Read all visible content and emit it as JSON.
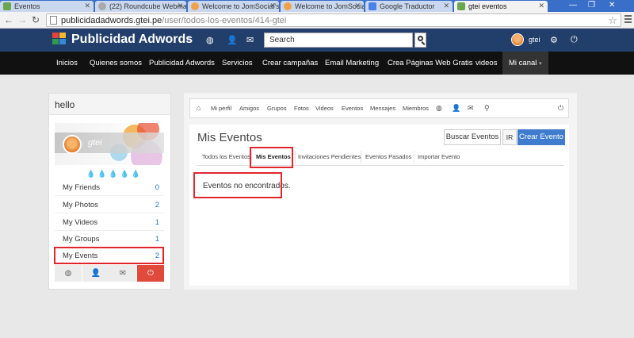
{
  "browser": {
    "tabs": [
      {
        "label": "Eventos",
        "active": false
      },
      {
        "label": "(22) Roundcube Webmail",
        "active": false
      },
      {
        "label": "Welcome to JomSocial's C",
        "active": false
      },
      {
        "label": "Welcome to JomSocial's C",
        "active": false
      },
      {
        "label": "Google Traductor",
        "active": false
      },
      {
        "label": "gtei eventos",
        "active": true
      }
    ],
    "url_host": "publicidadadwords.gtei.pe",
    "url_path": "/user/todos-los-eventos/414-gtei"
  },
  "header": {
    "site_title": "Publicidad Adwords",
    "search_placeholder": "Search",
    "username": "gtei"
  },
  "mainnav": {
    "items": [
      "Inicios",
      "Quienes somos",
      "Publicidad Adwords",
      "Servicios",
      "Crear campañas",
      "Email Marketing",
      "Crea Páginas Web Gratis",
      "videos"
    ],
    "active_item": "Mi canal"
  },
  "sidebar": {
    "title": "hello",
    "cover_name": "gtei",
    "rows": [
      {
        "label": "My Friends",
        "count": "0"
      },
      {
        "label": "My Photos",
        "count": "2"
      },
      {
        "label": "My Videos",
        "count": "1"
      },
      {
        "label": "My Groups",
        "count": "1"
      },
      {
        "label": "My Events",
        "count": "2"
      }
    ]
  },
  "profile_toolbar": {
    "items": [
      "Mi perfil",
      "Amigos",
      "Grupos",
      "Fotos",
      "Videos",
      "Eventos",
      "Mensajes",
      "Miembros"
    ]
  },
  "events": {
    "title": "Mis Eventos",
    "search_button": "Buscar Eventos",
    "ir_button": "IR",
    "create_button": "Crear Evento",
    "subtabs": [
      "Todos los Eventos",
      "Mis Eventos",
      "Invitaciones Pendientes",
      "Eventos Pasados",
      "Importar Evento"
    ],
    "empty_message": "Eventos no encontrados."
  },
  "colors": {
    "header_bg": "#223e6b",
    "nav_bg": "#111111",
    "highlight": "#e0262c",
    "primary_button": "#3f7ccd",
    "logout_tile": "#e04a3c"
  }
}
